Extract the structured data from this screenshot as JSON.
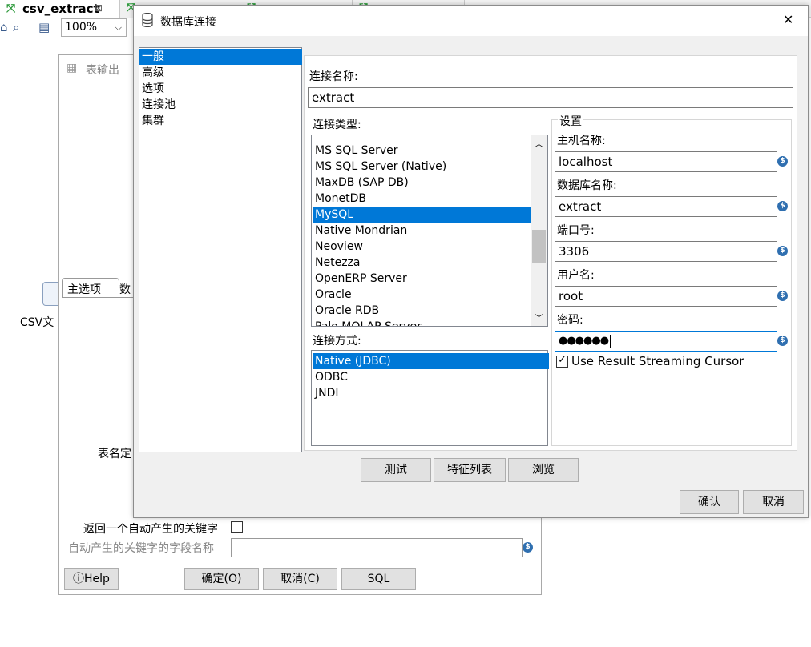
{
  "app": {
    "active_tab": "csv_extract",
    "zoom": "100%"
  },
  "bg_dialog": {
    "title": "表输出",
    "side_label": "CSV文",
    "tabs": [
      "主选项",
      "数"
    ],
    "table_name_label": "表名定",
    "return_key_label": "返回一个自动产生的关键字",
    "key_field_label": "自动产生的关键字的字段名称",
    "help": "Help",
    "ok": "确定(O)",
    "cancel": "取消(C)",
    "sql": "SQL"
  },
  "dialog": {
    "title": "数据库连接",
    "close_glyph": "✕",
    "nav": [
      "一般",
      "高级",
      "选项",
      "连接池",
      "集群"
    ],
    "nav_selected": 0,
    "conn_name_label": "连接名称:",
    "conn_name": "extract",
    "conn_type_label": "连接类型:",
    "conn_types": [
      "MS SQL Server",
      "MS SQL Server (Native)",
      "MaxDB (SAP DB)",
      "MonetDB",
      "MySQL",
      "Native Mondrian",
      "Neoview",
      "Netezza",
      "OpenERP Server",
      "Oracle",
      "Oracle RDB",
      "Palo MOLAP Server"
    ],
    "conn_type_selected": 4,
    "access_label": "连接方式:",
    "access_methods": [
      "Native (JDBC)",
      "ODBC",
      "JNDI"
    ],
    "access_selected": 0,
    "settings": {
      "group_label": "设置",
      "host_label": "主机名称:",
      "host": "localhost",
      "db_label": "数据库名称:",
      "db": "extract",
      "port_label": "端口号:",
      "port": "3306",
      "user_label": "用户名:",
      "user": "root",
      "password_label": "密码:",
      "password": "●●●●●●",
      "streaming_label": "Use Result Streaming Cursor",
      "streaming_checked": true
    },
    "buttons": {
      "test": "测试",
      "features": "特征列表",
      "explore": "浏览",
      "ok": "确认",
      "cancel": "取消"
    }
  }
}
